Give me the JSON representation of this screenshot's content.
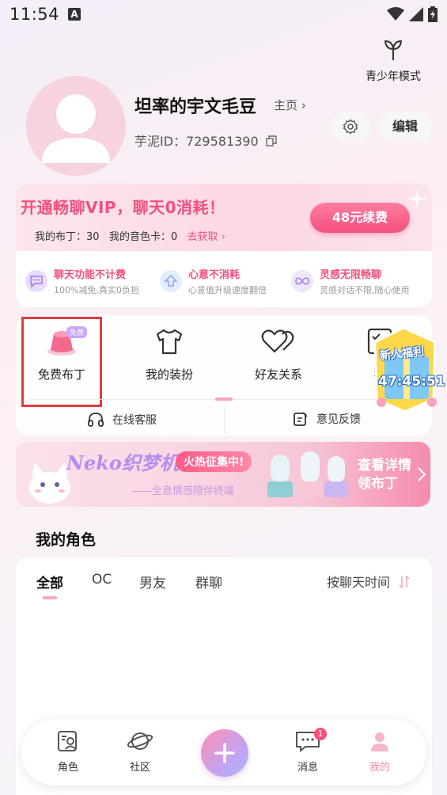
{
  "status_bar": {
    "time": "11:54",
    "notif_icon": "A"
  },
  "teen_mode": {
    "label": "青少年模式"
  },
  "profile": {
    "username": "坦率的宇文毛豆",
    "homepage_link": "主页 ›",
    "uid_label": "芋泥ID：",
    "uid": "729581390",
    "edit_label": "编辑"
  },
  "vip": {
    "title": "开通畅聊VIP，聊天0消耗！",
    "pudding_label": "我的布丁：",
    "pudding_count": "30",
    "voice_card_label": "我的音色卡：",
    "voice_card_count": "0",
    "get_link": "去获取 ›",
    "renew_label": "48元续费",
    "features": [
      {
        "title": "聊天功能不计费",
        "desc": "100%减免,真实0负担"
      },
      {
        "title": "心意不消耗",
        "desc": "心意值升级速度翻倍"
      },
      {
        "title": "灵感无限畅聊",
        "desc": "灵感对话不限,随心使用"
      }
    ]
  },
  "menu": {
    "items": [
      {
        "label": "免费布丁",
        "tag": "免费"
      },
      {
        "label": "我的装扮"
      },
      {
        "label": "好友关系"
      },
      {
        "label": "推"
      }
    ],
    "service_label": "在线客服",
    "feedback_label": "意见反馈"
  },
  "gift": {
    "title": "新人福利",
    "timer": "47:45:51"
  },
  "banner": {
    "title": "Neko织梦机",
    "pill": "火热征集中!",
    "subtitle": "——全息情感陪伴终端",
    "cta_line1": "查看详情",
    "cta_line2": "领布丁"
  },
  "roles": {
    "title": "我的角色",
    "tabs": [
      "全部",
      "OC",
      "男友",
      "群聊"
    ],
    "sort_label": "按聊天时间"
  },
  "nav": {
    "items": [
      {
        "label": "角色"
      },
      {
        "label": "社区"
      },
      {
        "label": "消息",
        "badge": "1"
      },
      {
        "label": "我的"
      }
    ]
  },
  "colors": {
    "accent": "#f0507e",
    "pink_light": "#fbd8e4",
    "highlight": "#e23b3b"
  }
}
